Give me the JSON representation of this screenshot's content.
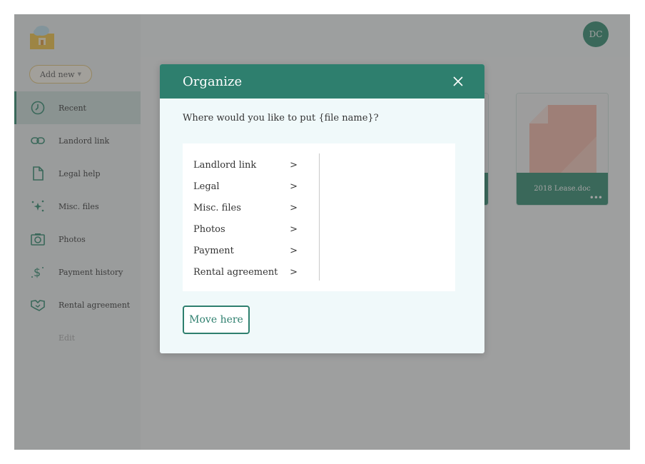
{
  "app": {
    "avatar_initials": "DC",
    "add_new_label": "Add new",
    "brand_color": "#2e8b6f",
    "nav": [
      {
        "label": "Recent",
        "icon": "clock-icon",
        "active": true
      },
      {
        "label": "Landord link",
        "icon": "link-icon"
      },
      {
        "label": "Legal help",
        "icon": "document-icon"
      },
      {
        "label": "Misc. files",
        "icon": "sparkle-icon"
      },
      {
        "label": "Photos",
        "icon": "camera-icon"
      },
      {
        "label": "Payment history",
        "icon": "dollar-icon"
      },
      {
        "label": "Rental agreement",
        "icon": "handshake-icon"
      }
    ],
    "edit_label": "Edit",
    "files": [
      {
        "name": "2018 Lease.doc"
      }
    ]
  },
  "modal": {
    "title": "Organize",
    "question": "Where would you like to put {file name}?",
    "folders": [
      {
        "label": "Landlord link"
      },
      {
        "label": "Legal"
      },
      {
        "label": "Misc. files"
      },
      {
        "label": "Photos"
      },
      {
        "label": "Payment"
      },
      {
        "label": "Rental agreement"
      }
    ],
    "move_button_label": "Move here",
    "header_color": "#2e7f6e"
  }
}
